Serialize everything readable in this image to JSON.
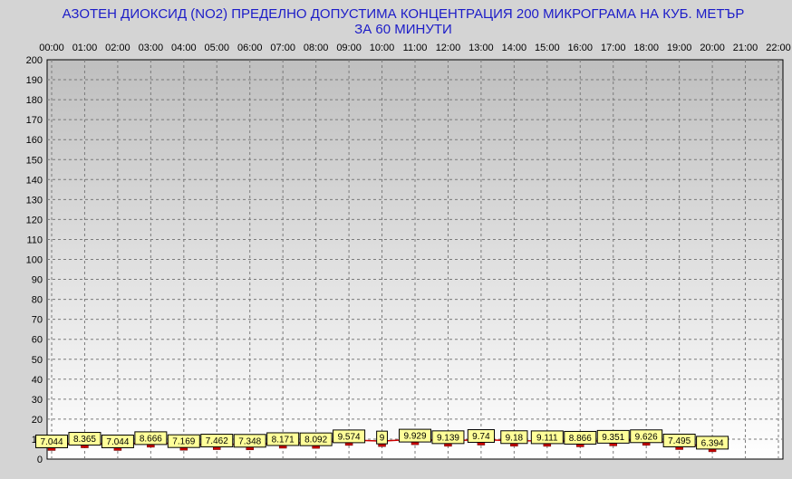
{
  "chart_data": {
    "type": "line",
    "title_line1": "АЗОТЕН ДИОКСИД   (NO2)     ПРЕДЕЛНО ДОПУСТИМА КОНЦЕНТРАЦИЯ 200 МИКРОГРАМА  НА КУБ. МЕТЪР",
    "title_line2": "ЗА 60 МИНУТИ",
    "categories": [
      "00:00",
      "01:00",
      "02:00",
      "03:00",
      "04:00",
      "05:00",
      "06:00",
      "07:00",
      "08:00",
      "09:00",
      "10:00",
      "11:00",
      "12:00",
      "13:00",
      "14:00",
      "15:00",
      "16:00",
      "17:00",
      "18:00",
      "19:00",
      "20:00",
      "21:00",
      "22:00"
    ],
    "values": [
      7.044,
      8.365,
      7.044,
      8.666,
      7.169,
      7.462,
      7.348,
      8.171,
      8.092,
      9.574,
      9,
      9.929,
      9.139,
      9.74,
      9.18,
      9.111,
      8.866,
      9.351,
      9.626,
      7.495,
      6.394
    ],
    "y_ticks": [
      0,
      10,
      20,
      30,
      40,
      50,
      60,
      70,
      80,
      90,
      100,
      110,
      120,
      130,
      140,
      150,
      160,
      170,
      180,
      190,
      200
    ],
    "ylim": [
      0,
      200
    ],
    "grid": true,
    "colors": {
      "background": "#d4d4d4",
      "plot_top": "#bfbfbf",
      "plot_bottom": "#ffffff",
      "title": "#1c1cc8",
      "line": "#cc0000",
      "marker": "#cc0000",
      "label_fill": "#ffff99"
    }
  }
}
